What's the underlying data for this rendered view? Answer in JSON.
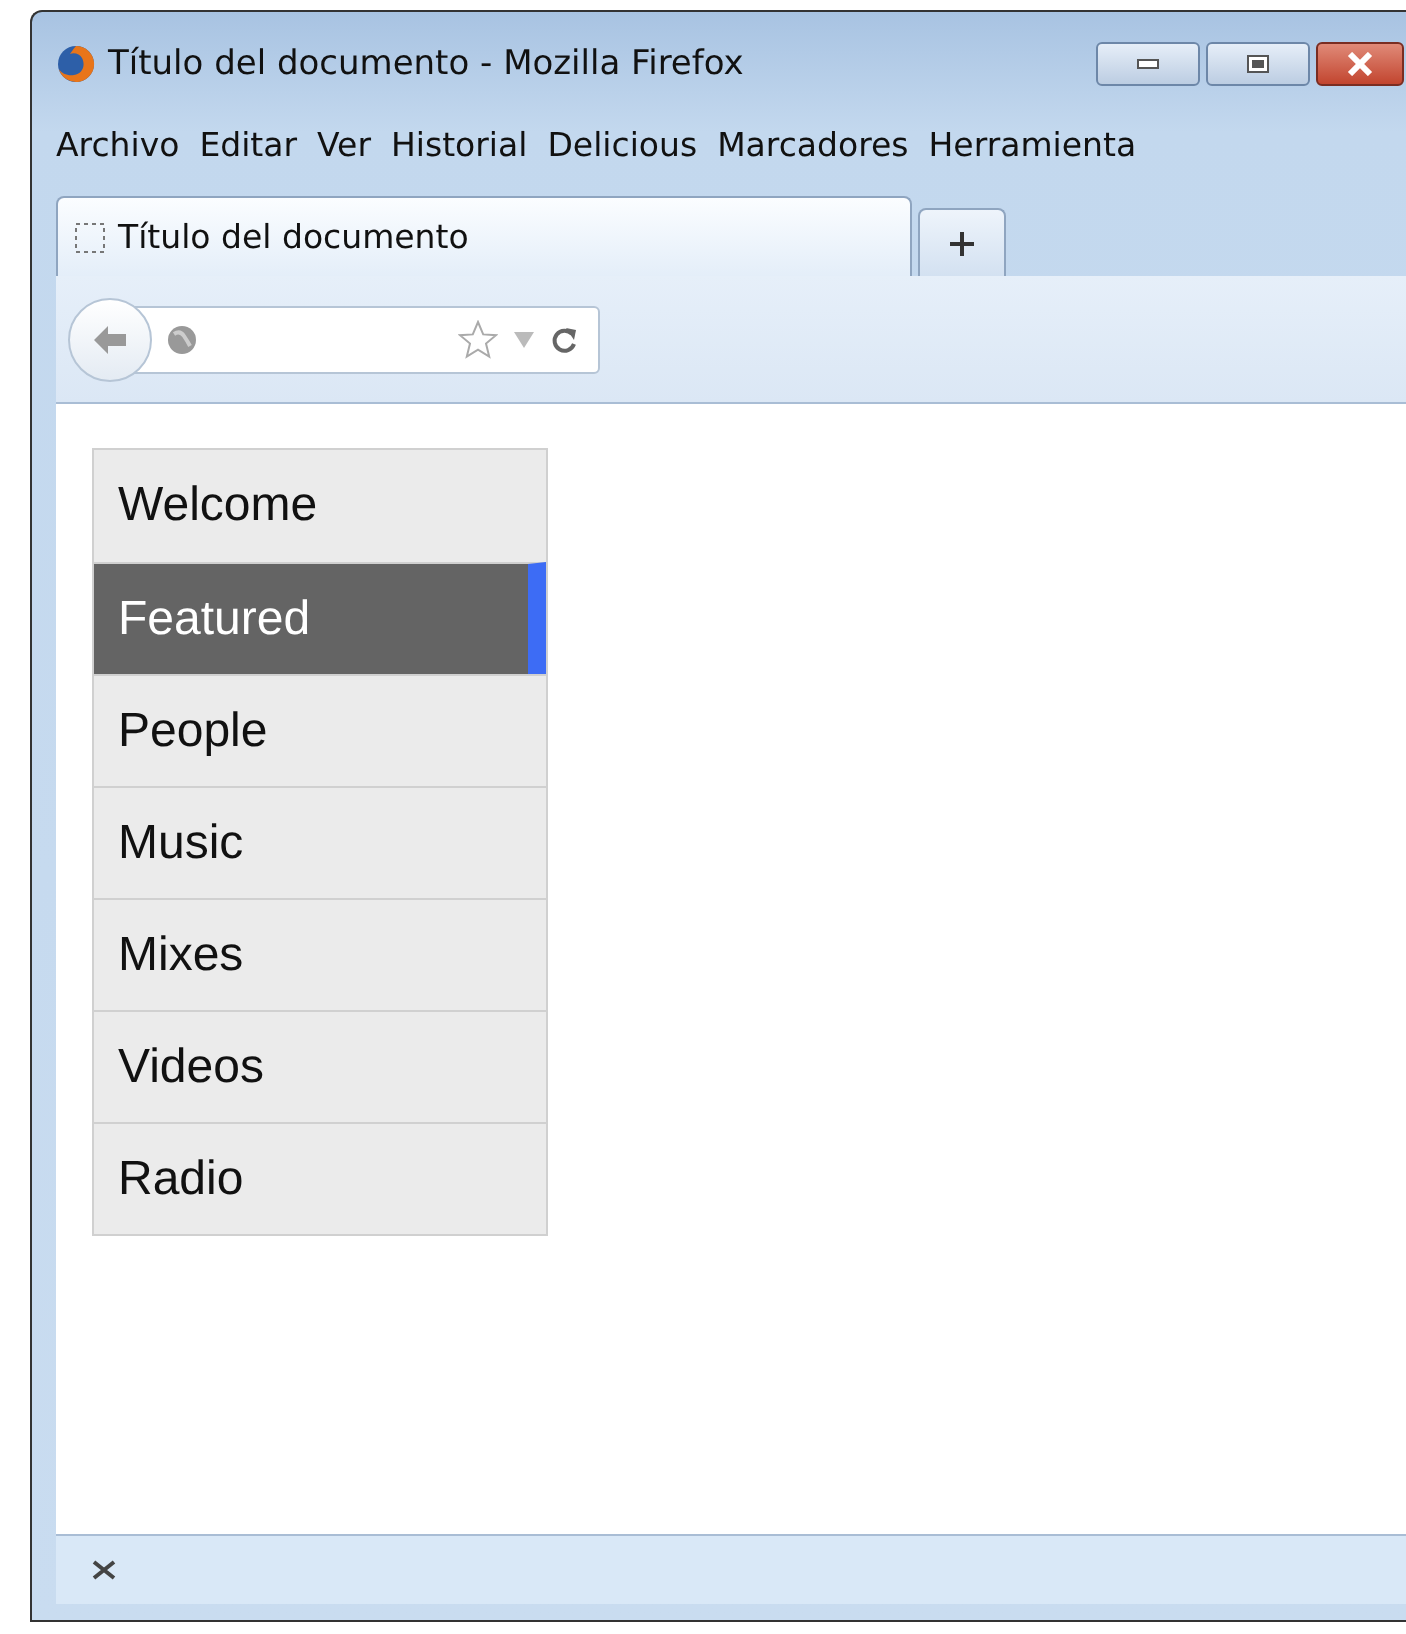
{
  "window": {
    "title": "Título del documento - Mozilla Firefox"
  },
  "menu_bar": [
    "Archivo",
    "Editar",
    "Ver",
    "Historial",
    "Delicious",
    "Marcadores",
    "Herramienta"
  ],
  "tabs": [
    {
      "label": "Título del documento",
      "selected": true
    }
  ],
  "nav_menu": [
    {
      "label": "Welcome",
      "selected": false
    },
    {
      "label": "Featured",
      "selected": true
    },
    {
      "label": "People",
      "selected": false
    },
    {
      "label": "Music",
      "selected": false
    },
    {
      "label": "Mixes",
      "selected": false
    },
    {
      "label": "Videos",
      "selected": false
    },
    {
      "label": "Radio",
      "selected": false
    }
  ]
}
